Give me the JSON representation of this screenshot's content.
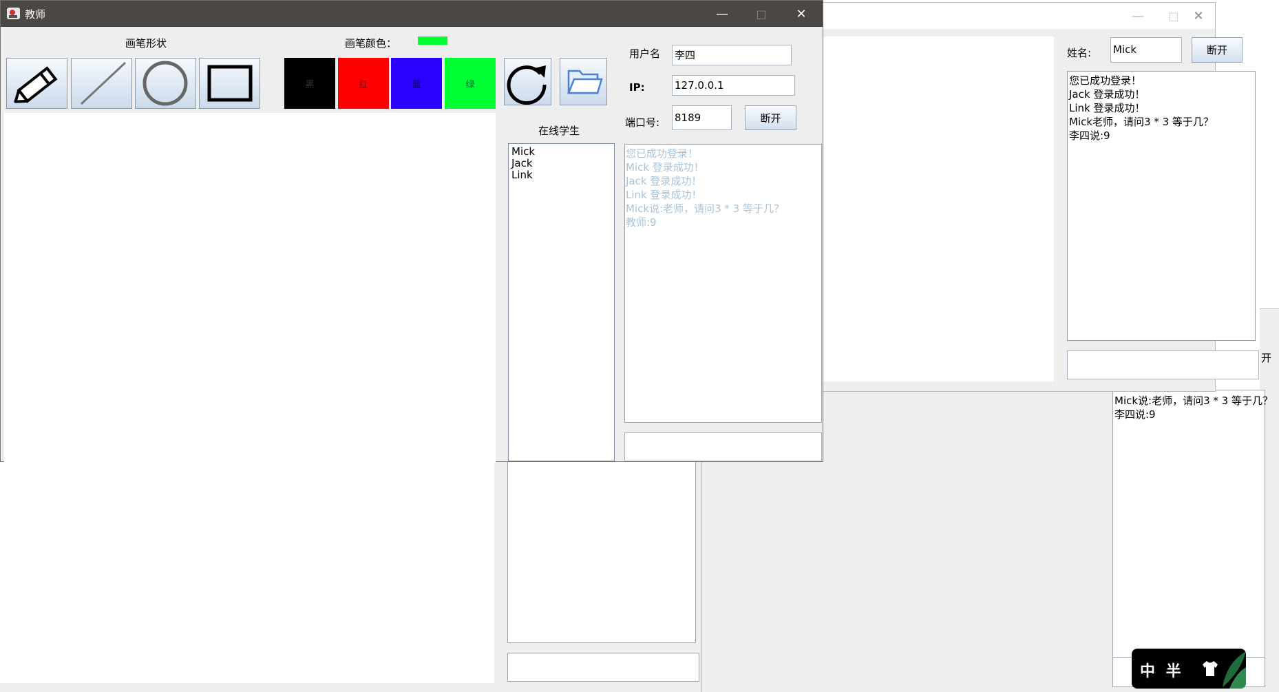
{
  "bg_windows": {
    "chat_lines": [
      "Mick说:老师，请问3 * 3 等于几？",
      "李四说:9"
    ],
    "partial_button": "开"
  },
  "student": {
    "name_label": "姓名:",
    "name_value": "Mick",
    "disconnect": "断开",
    "messages": [
      "您已成功登录！",
      "Jack 登录成功！",
      "Link 登录成功！",
      "Mick老师，请问3 * 3 等于几？",
      "李四说:9"
    ],
    "input_value": ""
  },
  "teacher": {
    "title": "教师",
    "pen_shape_label": "画笔形状",
    "pen_color_label": "画笔颜色：",
    "current_color": "#00ff33",
    "shape_tools": [
      "pencil-icon",
      "line-icon",
      "circle-icon",
      "rectangle-icon"
    ],
    "colors": [
      {
        "label": "黑",
        "hex": "#000000"
      },
      {
        "label": "红",
        "hex": "#ff0000"
      },
      {
        "label": "蓝",
        "hex": "#2b00ff"
      },
      {
        "label": "绿",
        "hex": "#00ff33"
      }
    ],
    "online_label": "在线学生",
    "students": [
      "Mick",
      "Jack",
      "Link"
    ],
    "username_label": "用户名",
    "username_value": "李四",
    "ip_label": "IP:",
    "ip_value": "127.0.0.1",
    "port_label": "端口号:",
    "port_value": "8189",
    "disconnect": "断开",
    "messages": [
      "您已成功登录！",
      "Mick 登录成功！",
      "Jack 登录成功！",
      "Link 登录成功！",
      "Mick说:老师，请问3 * 3 等于几？",
      "教师:9"
    ],
    "input_value": ""
  },
  "taskbar": {
    "badge_text": "中 半"
  },
  "colors": {
    "title_dark": "#4a4744",
    "window_bg": "#eeeeee",
    "faded_text": "#a8c3dc"
  }
}
